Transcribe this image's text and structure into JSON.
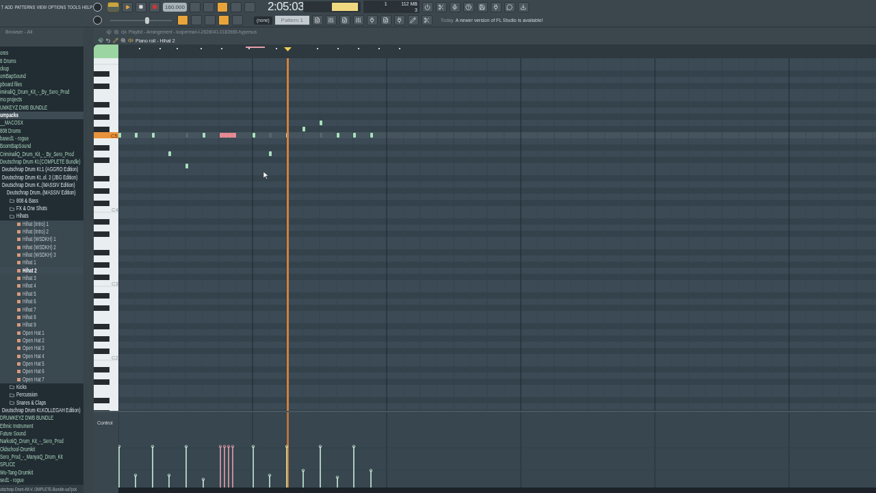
{
  "menu": [
    "T",
    "ADD",
    "PATTERNS",
    "VIEW",
    "OPTIONS",
    "TOOLS",
    "HELP"
  ],
  "transport": {
    "pat_mode": true,
    "tempo": "160.000",
    "time": "2:05:03"
  },
  "master_volume": {
    "level": 0.6
  },
  "memory": {
    "bar": "1",
    "ram": "112 MB",
    "voices": "3"
  },
  "toggles_top": [
    {
      "on": false
    },
    {
      "on": false
    },
    {
      "on": true
    },
    {
      "on": false
    },
    {
      "on": false
    }
  ],
  "toggles_bottom": [
    {
      "on": true
    },
    {
      "on": false
    },
    {
      "on": false
    },
    {
      "on": true
    },
    {
      "on": false
    }
  ],
  "pattern": {
    "snap": "(none)",
    "name": "Pattern 1"
  },
  "hint": {
    "day": "Today",
    "text": "A newer version of FL Studio is available!"
  },
  "browser": {
    "title": "Browser - All",
    "items": [
      {
        "label": "ores",
        "kind": "plain",
        "selected": false
      },
      {
        "label": "8 Drums",
        "kind": "plain",
        "selected": false
      },
      {
        "label": "ckup",
        "kind": "plain",
        "selected": false
      },
      {
        "label": "omBapSound",
        "kind": "plain",
        "selected": false
      },
      {
        "label": "pboard files",
        "kind": "plain",
        "selected": false
      },
      {
        "label": "iminaliQ_Drum_Kit_-_By_Sero_Prod",
        "kind": "plain",
        "selected": false
      },
      {
        "label": "mo projects",
        "kind": "plain",
        "selected": false
      },
      {
        "label": "UMKEYZ DWB BUNDLE",
        "kind": "plain",
        "selected": false
      },
      {
        "label": "umpacks",
        "kind": "plain",
        "selected": true,
        "children": [
          {
            "label": "__MACOSX",
            "kind": "plain",
            "selected": false
          },
          {
            "label": "808 Drums",
            "kind": "plain",
            "selected": false
          },
          {
            "label": "based1 - rogue",
            "kind": "plain",
            "selected": false
          },
          {
            "label": "BoomBapSound",
            "kind": "plain",
            "selected": false
          },
          {
            "label": "CriminaliQ_Drum_Kit_-_By_Sero_Prod",
            "kind": "plain",
            "selected": false
          },
          {
            "label": "Deutschrap Drum Kt.(COMPLETE Bundle)",
            "kind": "plain",
            "selected": false
          },
          {
            "label": "Deutschrap Drum Kt.1 (AGGRO Edition)",
            "kind": "folder",
            "selected": false
          },
          {
            "label": "Deutschrap Drum Kt..ol. 2 (JBG Edition)",
            "kind": "folder",
            "selected": false
          },
          {
            "label": "Deutschrap Drum K..(MASSIV Edition)",
            "kind": "folder",
            "selected": false,
            "children": [
              {
                "label": "Deutschrap Drum..(MASSIV Edition)",
                "kind": "folder",
                "selected": false,
                "children": [
                  {
                    "label": "808 & Bass",
                    "kind": "folder",
                    "selected": false
                  },
                  {
                    "label": "FX & One Shots",
                    "kind": "folder",
                    "selected": false
                  },
                  {
                    "label": "Hihats",
                    "kind": "folder",
                    "selected": false,
                    "children": [
                      {
                        "label": "Hihat (Intro) 1",
                        "kind": "file",
                        "selected": false
                      },
                      {
                        "label": "Hihat (Intro) 2",
                        "kind": "file",
                        "selected": false
                      },
                      {
                        "label": "Hihat (WSDKH) 1",
                        "kind": "file",
                        "selected": false
                      },
                      {
                        "label": "Hihat (WSDKH) 2",
                        "kind": "file",
                        "selected": false
                      },
                      {
                        "label": "Hihat (WSDKH) 3",
                        "kind": "file",
                        "selected": false
                      },
                      {
                        "label": "Hihat 1",
                        "kind": "file",
                        "selected": false
                      },
                      {
                        "label": "Hihat 2",
                        "kind": "file",
                        "selected": true
                      },
                      {
                        "label": "Hihat 3",
                        "kind": "file",
                        "selected": false
                      },
                      {
                        "label": "Hihat 4",
                        "kind": "file",
                        "selected": false
                      },
                      {
                        "label": "Hihat 5",
                        "kind": "file",
                        "selected": false
                      },
                      {
                        "label": "Hihat 6",
                        "kind": "file",
                        "selected": false
                      },
                      {
                        "label": "Hihat 7",
                        "kind": "file",
                        "selected": false
                      },
                      {
                        "label": "Hihat 8",
                        "kind": "file",
                        "selected": false
                      },
                      {
                        "label": "Hihat 9",
                        "kind": "file",
                        "selected": false
                      },
                      {
                        "label": "Open Hat 1",
                        "kind": "file",
                        "selected": false
                      },
                      {
                        "label": "Open Hat 2",
                        "kind": "file",
                        "selected": false
                      },
                      {
                        "label": "Open Hat 3",
                        "kind": "file",
                        "selected": false
                      },
                      {
                        "label": "Open Hat 4",
                        "kind": "file",
                        "selected": false
                      },
                      {
                        "label": "Open Hat 5",
                        "kind": "file",
                        "selected": false
                      },
                      {
                        "label": "Open Hat 6",
                        "kind": "file",
                        "selected": false
                      },
                      {
                        "label": "Open Hat 7",
                        "kind": "file",
                        "selected": false
                      }
                    ]
                  },
                  {
                    "label": "Kicks",
                    "kind": "folder",
                    "selected": false
                  },
                  {
                    "label": "Percussion",
                    "kind": "folder",
                    "selected": false
                  },
                  {
                    "label": "Snares & Claps",
                    "kind": "folder",
                    "selected": false
                  }
                ]
              }
            ]
          },
          {
            "label": "Deutschrap Drum Kt.KOLLEGAH Edition)",
            "kind": "folder",
            "selected": false
          },
          {
            "label": "DRUMKEYZ DWB BUNDLE",
            "kind": "plain",
            "selected": false
          },
          {
            "label": "Ethnic Instrument",
            "kind": "plain",
            "selected": false
          },
          {
            "label": "Future Sound",
            "kind": "plain",
            "selected": false
          },
          {
            "label": "NarkotiQ_Drum_Kit_-_Sero_Prod",
            "kind": "plain",
            "selected": false
          },
          {
            "label": "Oldschool-Drumkit",
            "kind": "plain",
            "selected": false
          },
          {
            "label": "Sero_Prod_-_ManyaQ_Drum_Kit",
            "kind": "plain",
            "selected": false
          },
          {
            "label": "SPLICE",
            "kind": "plain",
            "selected": false
          },
          {
            "label": "Wu-Tang-Drumkit",
            "kind": "plain",
            "selected": false
          }
        ]
      },
      {
        "label": "sed1 - rogue",
        "kind": "plain",
        "selected": false
      }
    ],
    "footer": "utschrap-Drum-Kit-V..OMPLETE-Bundle-ua7pck"
  },
  "playlist": {
    "title": "Playlist - Arrangement - looperman-l-2626041-0183965-hypersus"
  },
  "piano_roll": {
    "title": "Piano roll - Hihat 2",
    "key_labels": [
      "C5",
      "C4",
      "C3",
      "C2"
    ],
    "control": "Control"
  }
}
